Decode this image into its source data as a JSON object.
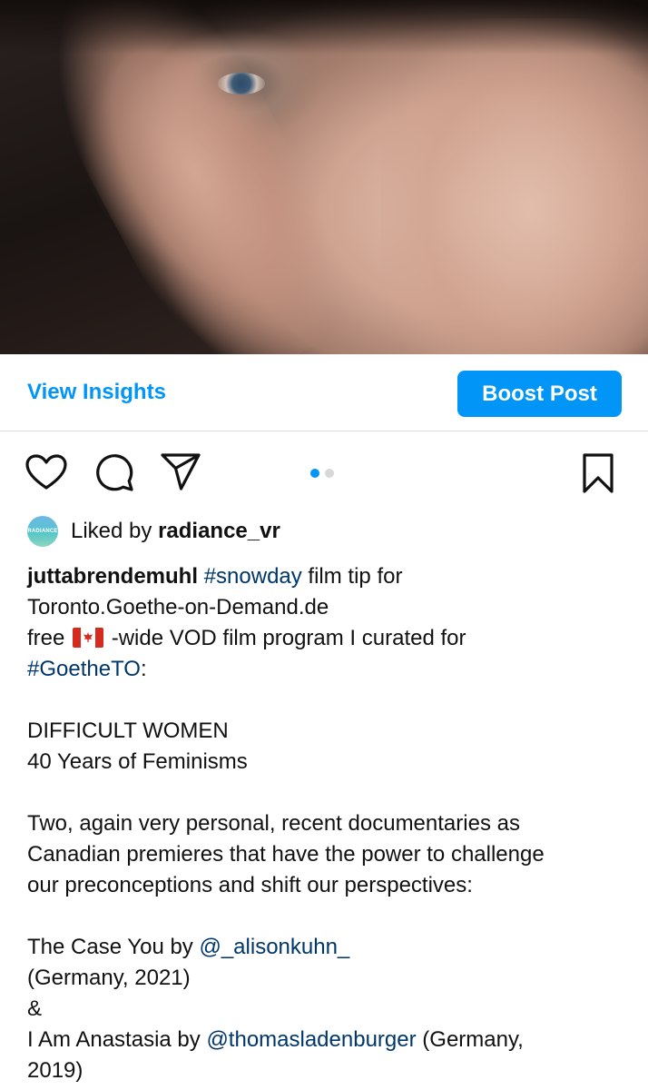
{
  "post": {
    "image_alt": "Blurred hand in front of a woman's face",
    "carousel": {
      "total": 2,
      "active": 1,
      "active_color": "#0095f6",
      "inactive_color": "#d8d8d8"
    }
  },
  "insights": {
    "view_label": "View Insights",
    "boost_label": "Boost Post",
    "accent_color": "#0095f6"
  },
  "actions": {
    "icons": [
      "heart-icon",
      "comment-icon",
      "share-icon",
      "bookmark-icon"
    ]
  },
  "likes": {
    "avatar_text": "RADIANCE",
    "prefix": "Liked by ",
    "user": "radiance_vr"
  },
  "caption": {
    "username": "juttabrendemuhl",
    "tag_snowday": "#snowday",
    "line1_rest": " film tip for",
    "line2": "Toronto.Goethe-on-Demand.de",
    "line3_start": "free ",
    "flag_icon": "canada-flag-icon",
    "line3_rest": " -wide VOD film program I curated for",
    "tag_goethe": "#GoetheTO",
    "tag_goethe_suffix": ":",
    "heading1": "DIFFICULT WOMEN",
    "heading2": "40 Years of Feminisms",
    "para_line1": "Two, again very personal, recent documentaries as",
    "para_line2": "Canadian premieres that have the power to challenge",
    "para_line3": "our preconceptions and shift our perspectives:",
    "film1_prefix": "The Case You by ",
    "film1_mention": "@_alisonkuhn_",
    "film1_meta": "(Germany, 2021)",
    "ampersand": "&",
    "film2_prefix": "I Am Anastasia by ",
    "film2_mention": "@thomasladenburger",
    "film2_meta_a": " (Germany,",
    "film2_meta_b": "2019)",
    "link_color": "#00376b"
  }
}
